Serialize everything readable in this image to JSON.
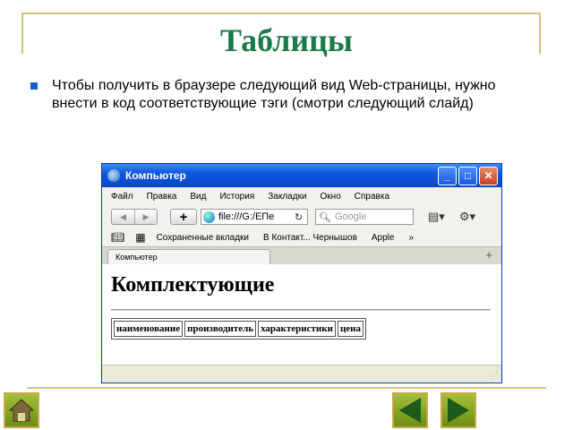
{
  "slide": {
    "title": "Таблицы",
    "bullet": "Чтобы получить в браузере следующий вид Web-страницы, нужно внести в код соответствующие тэги (смотри следующий слайд)"
  },
  "browser": {
    "window_title": "Компьютер",
    "menu": [
      "Файл",
      "Правка",
      "Вид",
      "История",
      "Закладки",
      "Окно",
      "Справка"
    ],
    "url": "file:///G:/EПе",
    "search_placeholder": "Google",
    "bookmarks": [
      "Сохраненные вкладки",
      "В Контакт... Чернышов",
      "Apple"
    ],
    "tab_label": "Компьютер",
    "page_heading": "Комплектующие",
    "table_headers": [
      "наименование",
      "производитель",
      "характеристики",
      "цена"
    ]
  },
  "icons": {
    "back": "back-arrow-icon",
    "forward": "forward-arrow-icon",
    "home": "home-icon",
    "prev": "previous-slide-icon",
    "next": "next-slide-icon"
  }
}
